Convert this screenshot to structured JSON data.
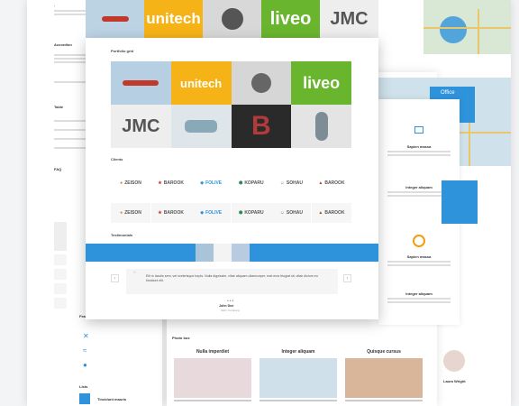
{
  "front": {
    "portfolio_title": "Portfolio grid",
    "clients_title": "Clients",
    "testimonials_title": "Testimonials",
    "grid_tiles": [
      "unitech",
      "liveo",
      "JMC"
    ],
    "clients_row1": [
      "ZEISON",
      "BAROOK",
      "FOLIVE",
      "KOPARU",
      "SOHAU",
      "BAROOK"
    ],
    "clients_row2": [
      "ZEISON",
      "BAROOK",
      "FOLIVE",
      "KOPARU",
      "SOHAU",
      "BAROOK"
    ],
    "quote_text": "Elit in iaculis sem, vel scelerisque turpis. Nulla dignissim, vitae aliquam ullamcorper, erat eros feugiat sit, vitae dictum eu tincidunt elit.",
    "author_name": "John Doe",
    "author_role": "CEO, Company"
  },
  "top_strip": [
    "unitech",
    "liveo",
    "JMC"
  ],
  "left": {
    "accordion_label": "Accordion",
    "table_label": "Table",
    "faq_label": "FAQ",
    "feature_list_label": "Feature list",
    "lists_label": "Lists",
    "theme_label": "Tincidunt mauris"
  },
  "right": {
    "office_label": "Office",
    "service_1": "Sapien massa",
    "service_2": "Integer aliquam",
    "service_3": "Sapien massa",
    "service_4": "Integer aliquam",
    "person_name": "Laura Wright"
  },
  "photobox": {
    "title": "Photo box",
    "items": [
      "Nulla imperdiet",
      "Integer aliquam",
      "Quisque cursus"
    ]
  },
  "colors": {
    "accent": "#2f93db",
    "unitech_bg": "#f6b318",
    "liveo_bg": "#6ab52e"
  }
}
